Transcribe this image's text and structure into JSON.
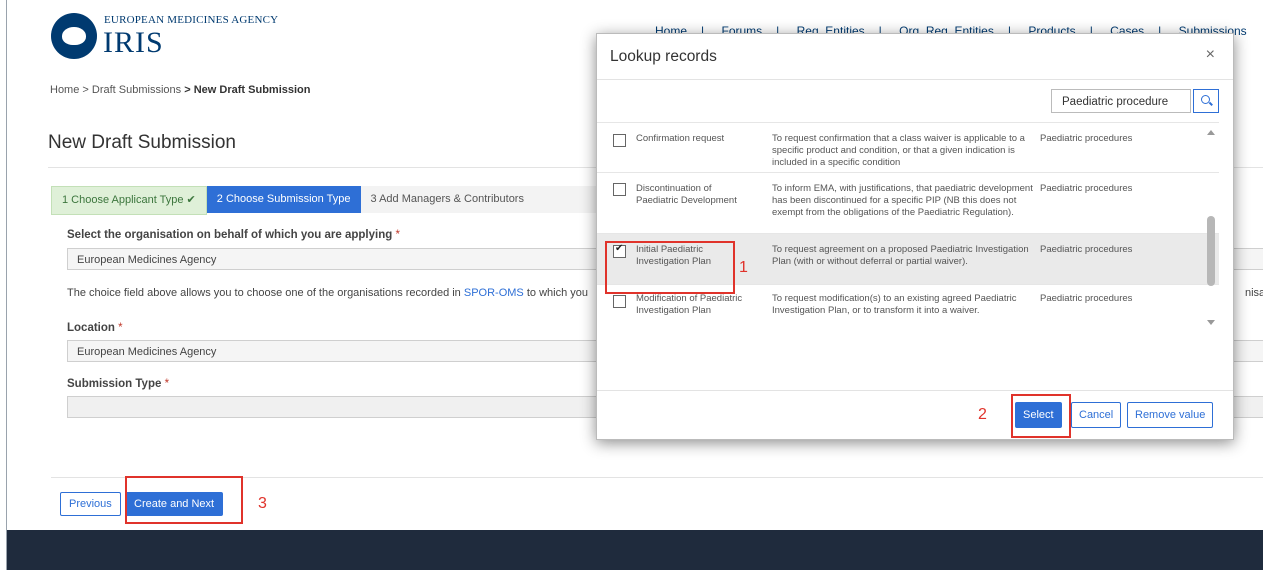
{
  "header": {
    "agency": "EUROPEAN MEDICINES AGENCY",
    "app_name": "IRIS",
    "nav": [
      "Home",
      "Forums",
      "Reg. Entities",
      "Org. Reg. Entities",
      "Products",
      "Cases",
      "Submissions"
    ]
  },
  "breadcrumb": {
    "home": "Home",
    "sep1": ">",
    "draft": "Draft Submissions",
    "sep2": ">",
    "current": "New Draft Submission"
  },
  "page_title": "New Draft Submission",
  "steps": [
    {
      "label": "1  Choose Applicant Type ✔"
    },
    {
      "label": "2  Choose Submission Type"
    },
    {
      "label": "3  Add Managers & Contributors"
    }
  ],
  "form": {
    "org_label": "Select the organisation on behalf of which you are applying",
    "org_value": "European Medicines Agency",
    "help_text_pre": "The choice field above allows you to choose one of the organisations recorded in",
    "help_link": "SPOR-OMS",
    "help_text_post": "to which you",
    "help_tail": "nisatio",
    "location_label": "Location",
    "location_value": "European Medicines Agency",
    "submission_type_label": "Submission Type",
    "submission_type_value": "",
    "required_mark": "*"
  },
  "buttons": {
    "previous": "Previous",
    "create_next": "Create and Next"
  },
  "modal": {
    "title": "Lookup records",
    "close": "×",
    "search_value": "Paediatric procedure",
    "rows": [
      {
        "name": "Confirmation request",
        "desc": "To request confirmation that a class waiver is applicable to a specific product and condition, or that a given indication is included in a specific condition",
        "area": "Paediatric procedures",
        "checked": false
      },
      {
        "name": "Discontinuation of Paediatric Development",
        "desc": "To inform EMA, with justifications, that paediatric development has been discontinued for a specific PIP (NB this does not exempt from the obligations of the Paediatric Regulation).",
        "area": "Paediatric procedures",
        "checked": false
      },
      {
        "name": "Initial Paediatric Investigation Plan",
        "desc": "To request agreement on a proposed Paediatric Investigation Plan (with or without deferral or partial waiver).",
        "area": "Paediatric procedures",
        "checked": true
      },
      {
        "name": "Modification of Paediatric Investigation Plan",
        "desc": "To request modification(s) to an existing agreed Paediatric Investigation Plan, or to transform it into a waiver.",
        "area": "Paediatric procedures",
        "checked": false
      }
    ],
    "select": "Select",
    "cancel": "Cancel",
    "remove": "Remove value"
  },
  "callouts": {
    "one": "1",
    "two": "2",
    "three": "3"
  }
}
